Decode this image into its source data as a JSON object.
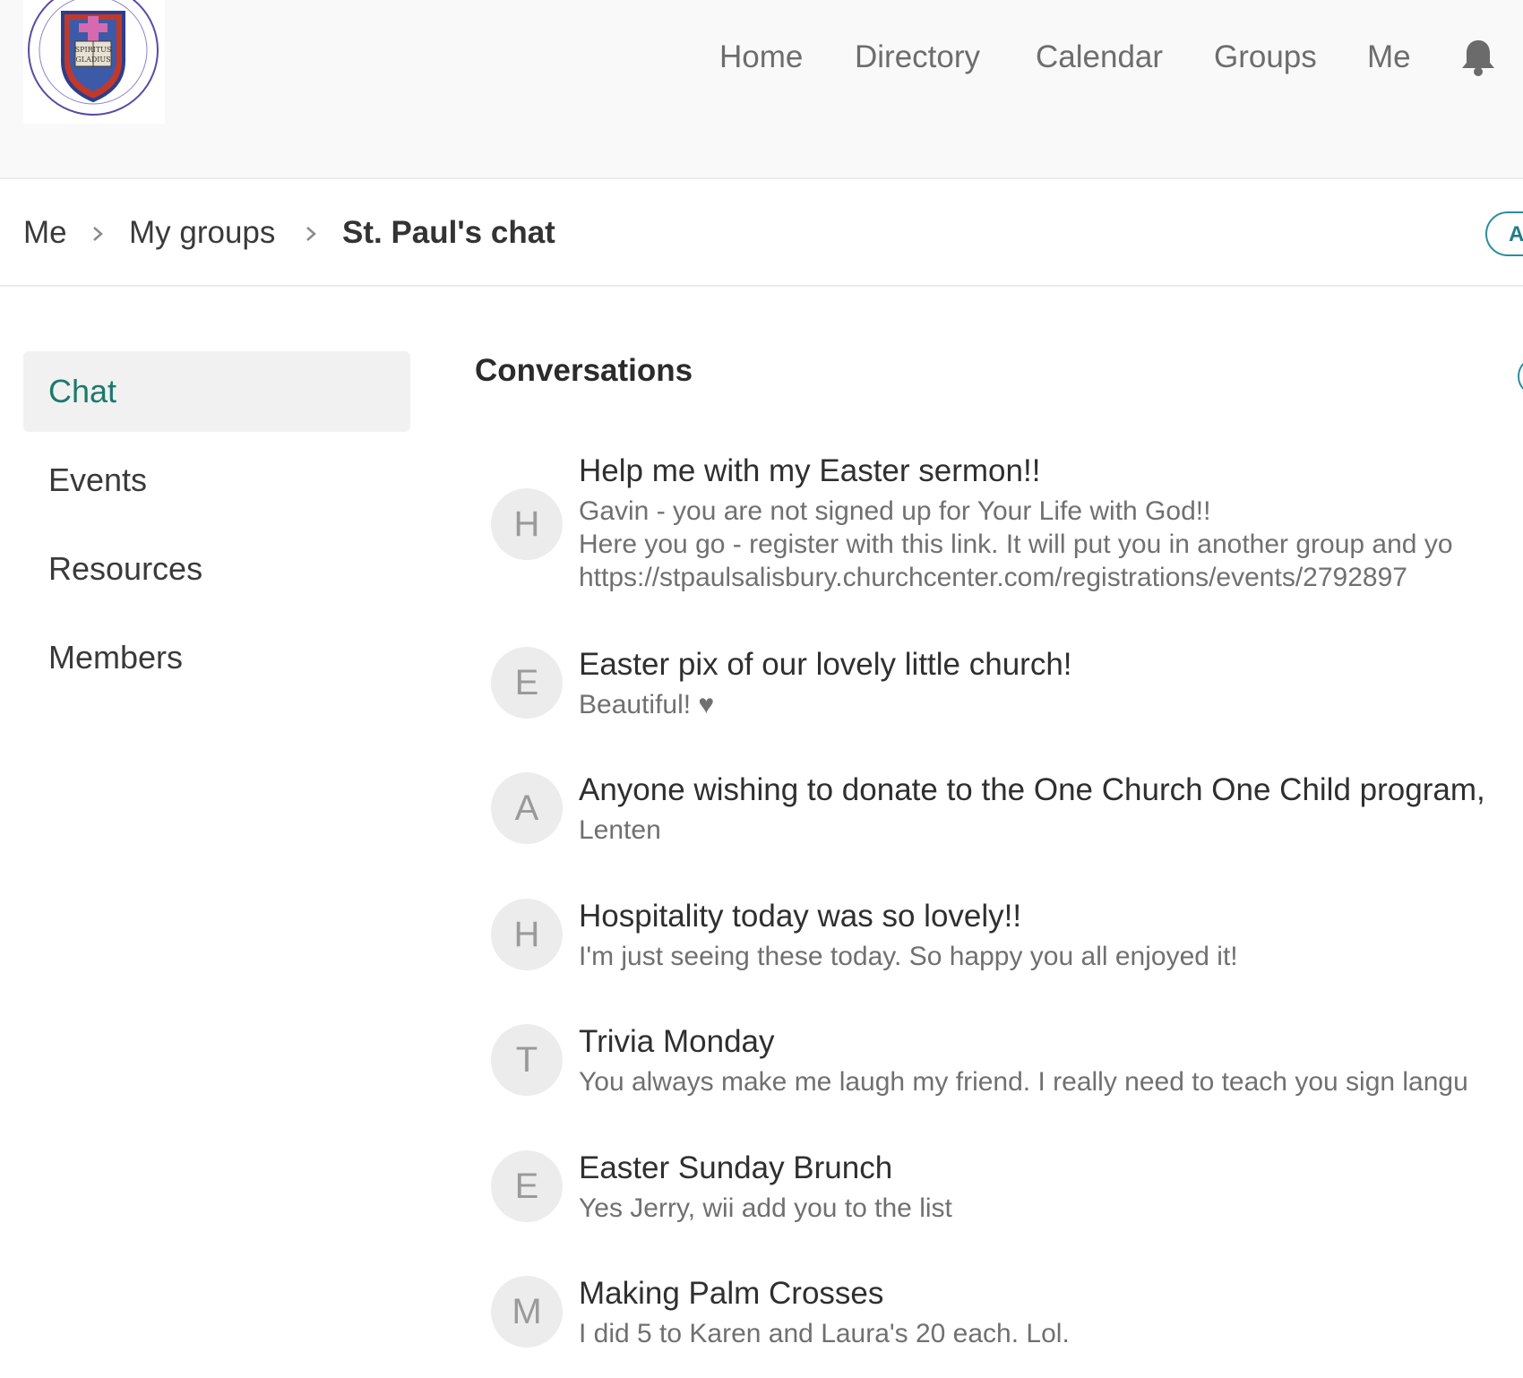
{
  "logo": {
    "name": "church-seal-logo",
    "text": "SPIRITUS GLADIUS"
  },
  "nav": {
    "items": [
      {
        "label": "Home"
      },
      {
        "label": "Directory"
      },
      {
        "label": "Calendar"
      },
      {
        "label": "Groups"
      },
      {
        "label": "Me"
      }
    ],
    "notification_icon": "bell-icon"
  },
  "breadcrumb": {
    "items": [
      "Me",
      "My groups",
      "St. Paul's chat"
    ],
    "separator_icon": "chevron-right-icon",
    "action_label": "A"
  },
  "sidebar": {
    "items": [
      {
        "label": "Chat",
        "active": true
      },
      {
        "label": "Events",
        "active": false
      },
      {
        "label": "Resources",
        "active": false
      },
      {
        "label": "Members",
        "active": false
      }
    ]
  },
  "conversations": {
    "heading": "Conversations",
    "items": [
      {
        "initial": "H",
        "title": "Help me with my Easter sermon!!",
        "lines": [
          "Gavin - you are not signed up for Your Life with God!!",
          "Here you go - register with this link. It will put you in another group and yo",
          "https://stpaulsalisbury.churchcenter.com/registrations/events/2792897"
        ]
      },
      {
        "initial": "E",
        "title": "Easter pix of our lovely little church!",
        "lines": [
          "Beautiful! ♥"
        ]
      },
      {
        "initial": "A",
        "title": "Anyone wishing to donate to the One Church One Child program,",
        "lines": [
          "Lenten"
        ]
      },
      {
        "initial": "H",
        "title": "Hospitality today was so lovely!!",
        "lines": [
          "I'm just seeing these today. So happy you all enjoyed it!"
        ]
      },
      {
        "initial": "T",
        "title": "Trivia Monday",
        "lines": [
          "You always make me laugh my friend. I really need to teach you sign langu"
        ]
      },
      {
        "initial": "E",
        "title": "Easter Sunday Brunch",
        "lines": [
          "Yes Jerry, wii add you to the list"
        ]
      },
      {
        "initial": "M",
        "title": "Making Palm Crosses",
        "lines": [
          "I did 5 to Karen and Laura's 20 each. Lol."
        ]
      }
    ]
  },
  "colors": {
    "accent_green": "#1a7a6b",
    "accent_teal": "#2a8d9c",
    "nav_text": "#6d6d6d"
  }
}
